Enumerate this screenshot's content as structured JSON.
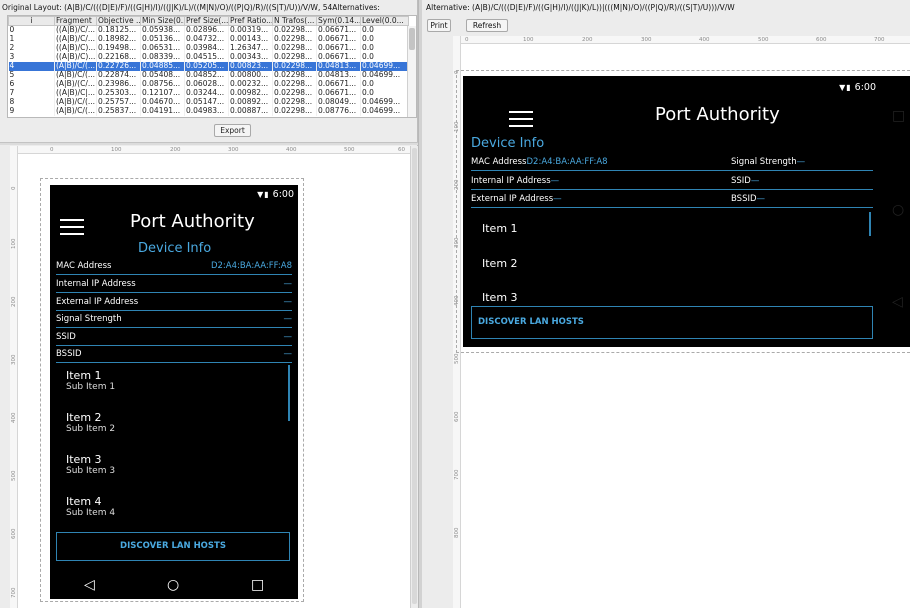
{
  "left_panel": {
    "title": "Original Layout: (A|B)/C/(((D|E)/F)/((G|H)/I)/((J|K)/L)/((M|N)/O)/((P|Q)/R)/((S|T)/U))/V/W, 54Alternatives:",
    "columns": [
      "i",
      "Fragment",
      "Objective ...",
      "Min Size(0...",
      "Pref Size(...",
      "Pref Ratio...",
      "N Trafos(...",
      "Sym(0.14...",
      "Level(0.0..."
    ],
    "rows": [
      [
        "0",
        "((A|B)/C/...",
        "0.18125...",
        "0.05938...",
        "0.02896...",
        "0.00319...",
        "0.02298...",
        "0.06671...",
        "0.0"
      ],
      [
        "1",
        "((A|B)/C/...",
        "0.18982...",
        "0.05136...",
        "0.04732...",
        "0.00143...",
        "0.02298...",
        "0.06671...",
        "0.0"
      ],
      [
        "2",
        "((A|B)/C)...",
        "0.19498...",
        "0.06531...",
        "0.03984...",
        "1.26347...",
        "0.02298...",
        "0.06671...",
        "0.0"
      ],
      [
        "3",
        "((A|B)/C)...",
        "0.22168...",
        "0.08339...",
        "0.04515...",
        "0.00343...",
        "0.02298...",
        "0.06671...",
        "0.0"
      ],
      [
        "4",
        "(A|B)/C/(...",
        "0.22726...",
        "0.04885...",
        "0.05205...",
        "0.00823...",
        "0.02298...",
        "0.04813...",
        "0.04699..."
      ],
      [
        "5",
        "(A|B)/C/(...",
        "0.22874...",
        "0.05408...",
        "0.04852...",
        "0.00800...",
        "0.02298...",
        "0.04813...",
        "0.04699..."
      ],
      [
        "6",
        "(A|B)/(C/...",
        "0.23986...",
        "0.08756...",
        "0.06028...",
        "0.00232...",
        "0.02298...",
        "0.06671...",
        "0.0"
      ],
      [
        "7",
        "((A|B)/C|...",
        "0.25303...",
        "0.12107...",
        "0.03244...",
        "0.00982...",
        "0.02298...",
        "0.06671...",
        "0.0"
      ],
      [
        "8",
        "(A|B)/C/(...",
        "0.25757...",
        "0.04670...",
        "0.05147...",
        "0.00892...",
        "0.02298...",
        "0.08049...",
        "0.04699..."
      ],
      [
        "9",
        "(A|B)/C/(...",
        "0.25837...",
        "0.04191...",
        "0.04983...",
        "0.00887...",
        "0.02298...",
        "0.08776...",
        "0.04699..."
      ]
    ],
    "selected_row": 4,
    "export_label": "Export",
    "ruler_h": [
      "0",
      "100",
      "200",
      "300",
      "400",
      "500",
      "60"
    ],
    "ruler_v": [
      "0",
      "100",
      "200",
      "300",
      "400",
      "500",
      "600",
      "700"
    ]
  },
  "right_panel": {
    "title": "Alternative: (A|B)/C/(((D|E)/F)/((G|H)/I)/((J|K)/L))|(((M|N)/O)/((P|Q)/R)/((S|T)/U)))/V/W",
    "print_label": "Print",
    "refresh_label": "Refresh",
    "ruler_h": [
      "0",
      "100",
      "200",
      "300",
      "400",
      "500",
      "600",
      "700"
    ],
    "ruler_v": [
      "0",
      "100",
      "200",
      "300",
      "400",
      "500",
      "600",
      "700",
      "800"
    ]
  },
  "app": {
    "status_time": "6:00",
    "title": "Port Authority",
    "section": "Device Info",
    "mac_label": "MAC Address",
    "mac_value": "D2:A4:BA:AA:FF:A8",
    "internal_ip_label": "Internal IP Address",
    "external_ip_label": "External IP Address",
    "signal_label": "Signal Strength",
    "ssid_label": "SSID",
    "bssid_label": "BSSID",
    "empty_value": "—",
    "items": [
      {
        "title": "Item 1",
        "sub": "Sub Item 1"
      },
      {
        "title": "Item 2",
        "sub": "Sub Item 2"
      },
      {
        "title": "Item 3",
        "sub": "Sub Item 3"
      },
      {
        "title": "Item 4",
        "sub": "Sub Item 4"
      }
    ],
    "discover_label": "DISCOVER LAN HOSTS",
    "nav_back": "◁",
    "nav_home": "○",
    "nav_recent": "□"
  },
  "colors": {
    "accent": "#4aa9e0",
    "divider": "#2f84b3",
    "selection": "#3875d7"
  }
}
